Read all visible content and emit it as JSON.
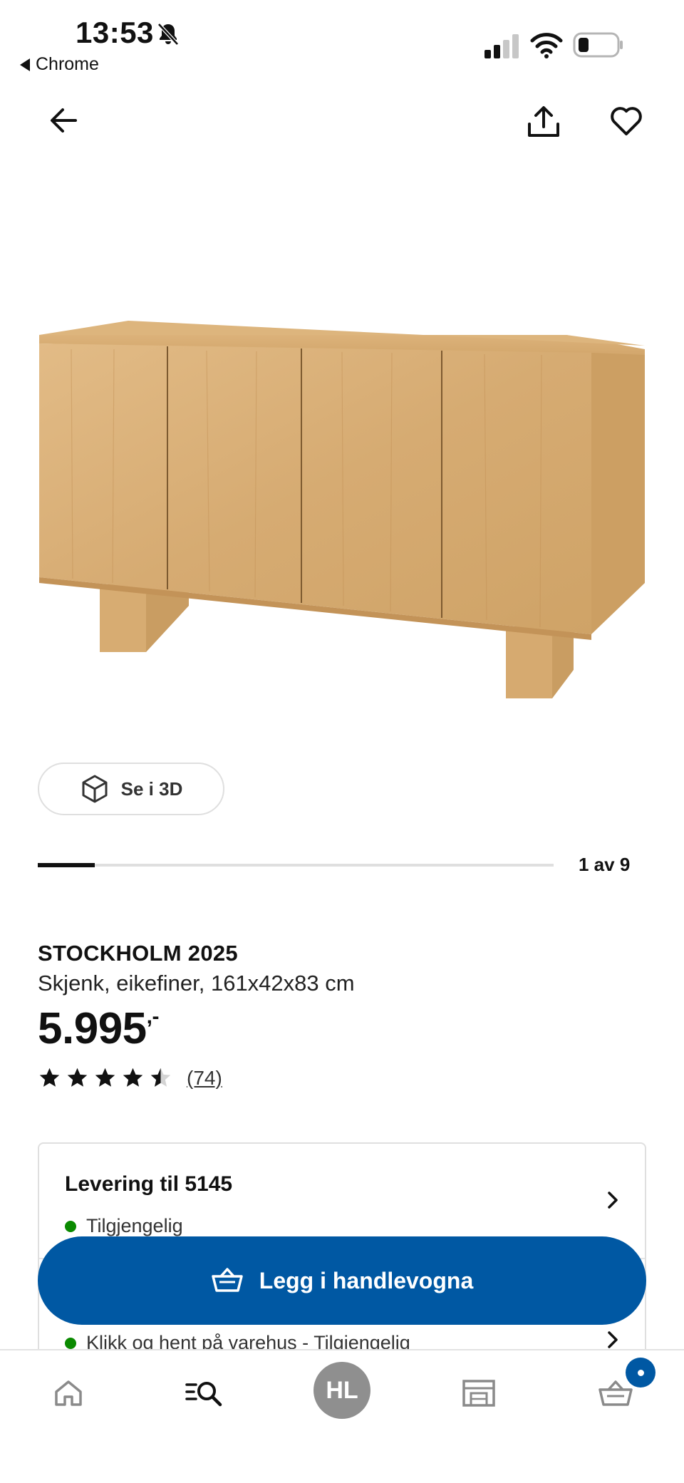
{
  "status_bar": {
    "time": "13:53",
    "back_app": "Chrome",
    "icons": [
      "bell-slash-icon",
      "signal-icon",
      "wifi-icon",
      "battery-icon"
    ]
  },
  "nav": {
    "icons": [
      "arrow-left-icon",
      "share-icon",
      "heart-icon"
    ]
  },
  "gallery": {
    "view_3d_label": "Se i 3D",
    "position_text": "1 av 9",
    "progress_fraction": 0.111
  },
  "product": {
    "name": "STOCKHOLM 2025",
    "description": "Skjenk, eikefiner, 161x42x83 cm",
    "price": "5.995",
    "price_suffix": ",-",
    "rating": 4.5,
    "reviews": "(74)"
  },
  "delivery": {
    "title": "Levering til 5145",
    "status": "Tilgjengelig",
    "pickup_status": "Klikk og hent på varehus - Tilgjengelig",
    "status_color": "#0a8a00"
  },
  "cta": {
    "label": "Legg i handlevogna",
    "color": "#0058a3"
  },
  "bottom_nav": {
    "avatar_initials": "HL",
    "icons": [
      "home-icon",
      "search-list-icon",
      "avatar",
      "store-icon",
      "cart-icon"
    ]
  }
}
